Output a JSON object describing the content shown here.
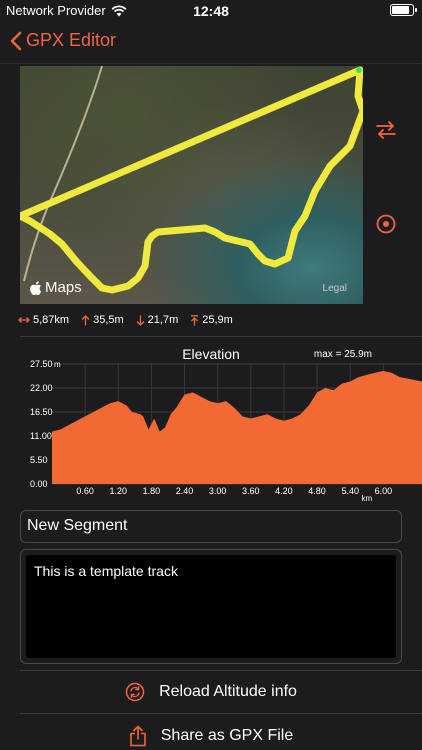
{
  "status": {
    "provider": "Network Provider",
    "time": "12:48",
    "battery_level": 0.9
  },
  "nav": {
    "back_label": "GPX Editor"
  },
  "map": {
    "logo": "Maps",
    "legal": "Legal",
    "track_color": "#f0ea3c"
  },
  "side_buttons": {
    "swap_icon": "swap-arrows-icon",
    "locate_icon": "target-icon"
  },
  "stats": {
    "distance": "5,87km",
    "ascent": "35,5m",
    "descent": "21,7m",
    "max_altitude": "25,9m"
  },
  "chart_data": {
    "type": "area",
    "title": "Elevation",
    "annotation": "max = 25.9m",
    "xlabel": "km",
    "ylabel_unit": "m",
    "xlim": [
      0,
      6.7
    ],
    "ylim": [
      0,
      27.5
    ],
    "x_ticks": [
      "0.60",
      "1.20",
      "1.80",
      "2.40",
      "3.00",
      "3.60",
      "4.20",
      "4.80",
      "5.40",
      "6.00"
    ],
    "y_ticks": [
      "0.00",
      "5.50",
      "11.00",
      "16.50",
      "22.00",
      "27.50"
    ],
    "fill_color": "#f26a33",
    "series": [
      {
        "x": [
          0,
          0.15,
          0.3,
          0.45,
          0.6,
          0.75,
          0.9,
          1.05,
          1.2,
          1.35,
          1.45,
          1.6,
          1.65,
          1.75,
          1.85,
          1.95,
          2.05,
          2.15,
          2.25,
          2.4,
          2.55,
          2.7,
          2.85,
          3.0,
          3.15,
          3.3,
          3.45,
          3.6,
          3.75,
          3.9,
          4.05,
          4.2,
          4.35,
          4.5,
          4.65,
          4.8,
          4.95,
          5.1,
          5.25,
          5.4,
          5.55,
          5.7,
          5.85,
          6.0,
          6.15,
          6.3,
          6.5,
          6.7
        ],
        "values": [
          12.0,
          12.5,
          13.5,
          14.5,
          15.5,
          16.5,
          17.5,
          18.5,
          19.0,
          18.0,
          16.5,
          16.0,
          15.5,
          12.5,
          15.0,
          12.0,
          13.0,
          16.0,
          17.5,
          20.5,
          21.0,
          20.0,
          19.0,
          18.5,
          19.0,
          17.5,
          15.5,
          15.0,
          15.5,
          16.0,
          15.0,
          14.5,
          15.0,
          16.0,
          18.0,
          21.0,
          22.0,
          21.5,
          23.0,
          23.5,
          24.5,
          25.0,
          25.5,
          25.9,
          25.5,
          24.5,
          24.0,
          23.5
        ]
      }
    ]
  },
  "segment": {
    "name": "New Segment"
  },
  "description": {
    "text": "This is a template track"
  },
  "actions": {
    "reload_label": "Reload Altitude info",
    "reload_icon": "refresh-circle-icon",
    "share_label": "Share as GPX File",
    "share_icon": "share-icon"
  },
  "colors": {
    "accent": "#f2663a",
    "background": "#1c1c1e"
  }
}
